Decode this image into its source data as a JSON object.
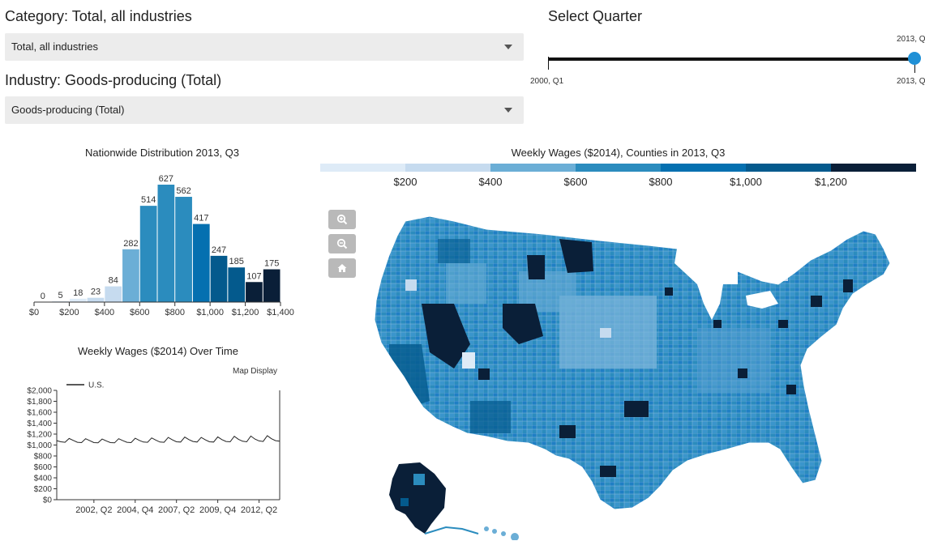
{
  "category": {
    "heading": "Category: Total, all industries",
    "selected": "Total, all industries"
  },
  "industry": {
    "heading": "Industry: Goods-producing (Total)",
    "selected": "Goods-producing (Total)"
  },
  "quarter_slider": {
    "heading": "Select Quarter",
    "min_label": "2000, Q1",
    "max_label_top": "2013, Q",
    "max_label_bottom": "2013, Q",
    "value_fraction": 1.0
  },
  "histogram": {
    "title": "Nationwide Distribution 2013, Q3"
  },
  "legend": {
    "title": "Weekly Wages ($2014), Counties in 2013, Q3",
    "labels": [
      "$200",
      "$400",
      "$600",
      "$800",
      "$1,000",
      "$1,200"
    ],
    "colors": [
      "#deebf7",
      "#c6dbef",
      "#6baed6",
      "#2b8cbe",
      "#0570b0",
      "#045a8d",
      "#0a1f38"
    ]
  },
  "timeseries": {
    "title": "Weekly Wages ($2014) Over Time",
    "map_display_label": "Map Display",
    "legend_label": "U.S."
  },
  "map": {
    "zoom_in_icon": "zoom-in-icon",
    "zoom_out_icon": "zoom-out-icon",
    "home_icon": "home-icon"
  },
  "chart_data": [
    {
      "type": "bar",
      "title": "Nationwide Distribution 2013, Q3",
      "bin_edges": [
        0,
        100,
        200,
        300,
        400,
        500,
        600,
        700,
        800,
        900,
        1000,
        1100,
        1200,
        1300,
        1400
      ],
      "values": [
        0,
        5,
        18,
        23,
        84,
        282,
        514,
        627,
        562,
        417,
        247,
        185,
        107,
        175
      ],
      "bar_colors": [
        "#deebf7",
        "#deebf7",
        "#deebf7",
        "#c6dbef",
        "#c6dbef",
        "#6baed6",
        "#2b8cbe",
        "#2b8cbe",
        "#2b8cbe",
        "#0570b0",
        "#045a8d",
        "#045a8d",
        "#0a1f38",
        "#0a1f38"
      ],
      "x_ticks": [
        "$0",
        "$200",
        "$400",
        "$600",
        "$800",
        "$1,000",
        "$1,200",
        "$1,400"
      ],
      "xlim": [
        0,
        1400
      ]
    },
    {
      "type": "line",
      "title": "Weekly Wages ($2014) Over Time",
      "series": [
        {
          "name": "U.S.",
          "x": [
            "2000, Q1",
            "2000, Q2",
            "2000, Q3",
            "2000, Q4",
            "2001, Q1",
            "2001, Q2",
            "2001, Q3",
            "2001, Q4",
            "2002, Q1",
            "2002, Q2",
            "2002, Q3",
            "2002, Q4",
            "2003, Q1",
            "2003, Q2",
            "2003, Q3",
            "2003, Q4",
            "2004, Q1",
            "2004, Q2",
            "2004, Q3",
            "2004, Q4",
            "2005, Q1",
            "2005, Q2",
            "2005, Q3",
            "2005, Q4",
            "2006, Q1",
            "2006, Q2",
            "2006, Q3",
            "2006, Q4",
            "2007, Q1",
            "2007, Q2",
            "2007, Q3",
            "2007, Q4",
            "2008, Q1",
            "2008, Q2",
            "2008, Q3",
            "2008, Q4",
            "2009, Q1",
            "2009, Q2",
            "2009, Q3",
            "2009, Q4",
            "2010, Q1",
            "2010, Q2",
            "2010, Q3",
            "2010, Q4",
            "2011, Q1",
            "2011, Q2",
            "2011, Q3",
            "2011, Q4",
            "2012, Q1",
            "2012, Q2",
            "2012, Q3",
            "2012, Q4",
            "2013, Q1",
            "2013, Q2",
            "2013, Q3"
          ],
          "values": [
            1080,
            1060,
            1050,
            1120,
            1085,
            1050,
            1045,
            1115,
            1080,
            1045,
            1040,
            1110,
            1075,
            1045,
            1040,
            1115,
            1080,
            1050,
            1045,
            1125,
            1085,
            1055,
            1050,
            1130,
            1090,
            1055,
            1050,
            1140,
            1095,
            1060,
            1055,
            1145,
            1100,
            1065,
            1055,
            1140,
            1095,
            1060,
            1055,
            1150,
            1100,
            1065,
            1060,
            1160,
            1105,
            1070,
            1060,
            1165,
            1110,
            1075,
            1065,
            1170,
            1115,
            1080,
            1070
          ]
        }
      ],
      "x_ticks": [
        "2002, Q2",
        "2004, Q4",
        "2007, Q2",
        "2009, Q4",
        "2012, Q2"
      ],
      "y_ticks": [
        "$2,000",
        "$1,800",
        "$1,600",
        "$1,400",
        "$1,200",
        "$1,000",
        "$800",
        "$600",
        "$400",
        "$200",
        "$0"
      ],
      "ylim": [
        0,
        2000
      ]
    }
  ]
}
